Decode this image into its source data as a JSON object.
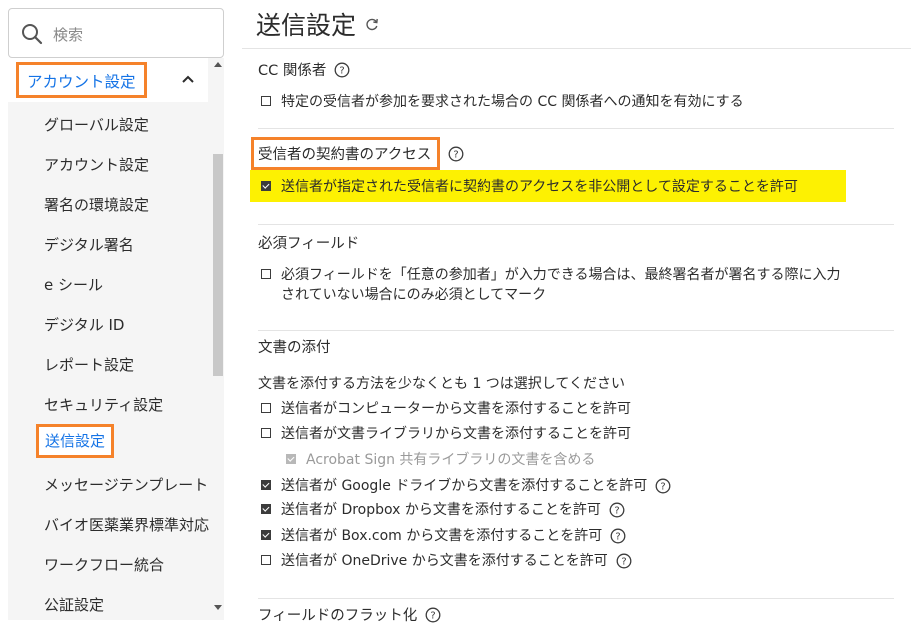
{
  "search": {
    "placeholder": "検索"
  },
  "sidebar": {
    "section_label": "アカウント設定",
    "items": [
      {
        "label": "グローバル設定"
      },
      {
        "label": "アカウント設定"
      },
      {
        "label": "署名の環境設定"
      },
      {
        "label": "デジタル署名"
      },
      {
        "label": "e シール"
      },
      {
        "label": "デジタル ID"
      },
      {
        "label": "レポート設定"
      },
      {
        "label": "セキュリティ設定"
      },
      {
        "label": "送信設定",
        "active": true
      },
      {
        "label": "メッセージテンプレート"
      },
      {
        "label": "バイオ医薬業界標準対応"
      },
      {
        "label": "ワークフロー統合"
      },
      {
        "label": "公証設定"
      }
    ]
  },
  "main": {
    "title": "送信設定",
    "cc": {
      "heading": "CC 関係者",
      "option": "特定の受信者が参加を要求された場合の CC 関係者への通知を有効にする"
    },
    "recipient_access": {
      "heading": "受信者の契約書のアクセス",
      "option": "送信者が指定された受信者に契約書のアクセスを非公開として設定することを許可"
    },
    "required_fields": {
      "heading": "必須フィールド",
      "option_line1": "必須フィールドを「任意の参加者」が入力できる場合は、最終署名者が署名する際に入力",
      "option_line2": "されていない場合にのみ必須としてマーク"
    },
    "attachments": {
      "heading": "文書の添付",
      "description": "文書を添付する方法を少なくとも 1 つは選択してください",
      "options": [
        {
          "label": "送信者がコンピューターから文書を添付することを許可",
          "checked": false
        },
        {
          "label": "送信者が文書ライブラリから文書を添付することを許可",
          "checked": false
        },
        {
          "label": "Acrobat Sign 共有ライブラリの文書を含める",
          "checked": true,
          "disabled": true
        },
        {
          "label": "送信者が Google ドライブから文書を添付することを許可",
          "checked": true
        },
        {
          "label": "送信者が Dropbox から文書を添付することを許可",
          "checked": true
        },
        {
          "label": "送信者が Box.com から文書を添付することを許可",
          "checked": true
        },
        {
          "label": "送信者が OneDrive から文書を添付することを許可",
          "checked": false
        }
      ]
    },
    "flatten": {
      "heading": "フィールドのフラット化"
    }
  },
  "colors": {
    "accent": "#1473e6",
    "callout": "#f5822a",
    "highlight": "#fdf102"
  }
}
